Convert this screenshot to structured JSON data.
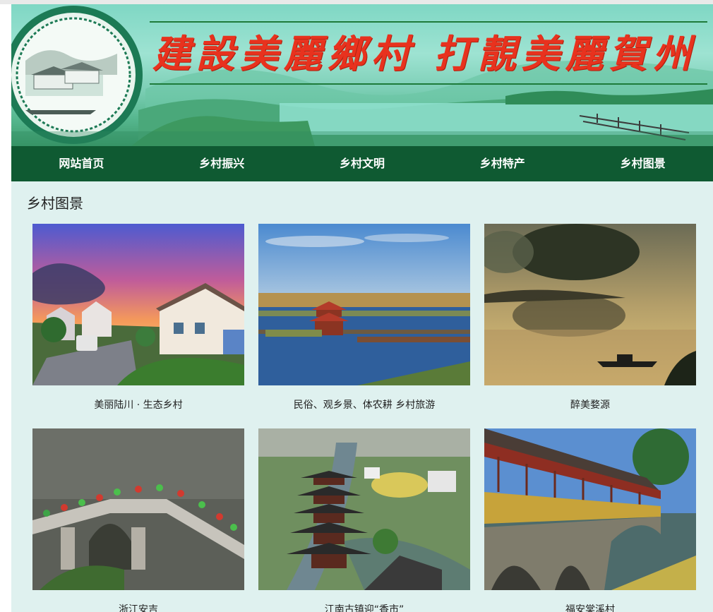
{
  "banner": {
    "slogan": "建設美麗鄉村 打靚美麗賀州"
  },
  "nav": {
    "items": [
      {
        "label": "网站首页"
      },
      {
        "label": "乡村振兴"
      },
      {
        "label": "乡村文明"
      },
      {
        "label": "乡村特产"
      },
      {
        "label": "乡村图景"
      }
    ]
  },
  "section": {
    "title": "乡村图景"
  },
  "gallery": [
    {
      "caption": "美丽陆川 · 生态乡村",
      "scene": "village-sunset"
    },
    {
      "caption": "民俗、观乡景、体农耕  乡村旅游",
      "scene": "lake-pavilion"
    },
    {
      "caption": "醉美婺源",
      "scene": "misty-river-boat"
    },
    {
      "caption": "浙江安吉",
      "scene": "arch-bridge-crowd"
    },
    {
      "caption": "江南古镇迎“香市”",
      "scene": "pagoda-canal"
    },
    {
      "caption": "福安棠溪村",
      "scene": "covered-bridge"
    }
  ],
  "colors": {
    "nav_bg": "#0f5a32",
    "page_bg": "#dff1ef",
    "slogan": "#e8321e"
  }
}
